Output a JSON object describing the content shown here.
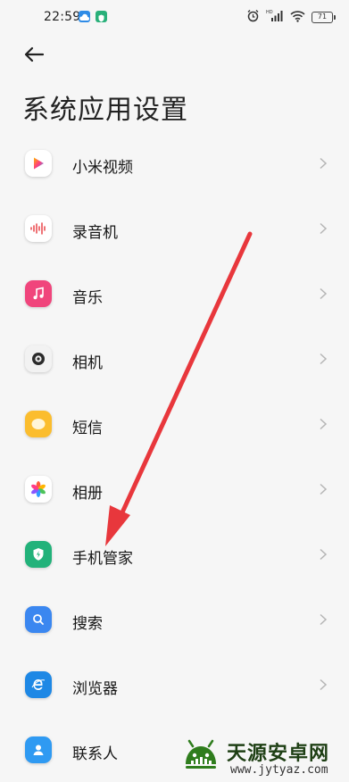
{
  "status_bar": {
    "time": "22:59",
    "battery": "71",
    "icons": [
      "cloud-icon",
      "shield-icon",
      "alarm-icon",
      "hd-signal-icon",
      "wifi-icon",
      "battery-icon"
    ]
  },
  "header": {
    "back_icon": "back-arrow-icon",
    "title": "系统应用设置"
  },
  "settings_list": [
    {
      "label": "小米视频",
      "icon": "video-play-icon"
    },
    {
      "label": "录音机",
      "icon": "recorder-waveform-icon"
    },
    {
      "label": "音乐",
      "icon": "music-note-icon"
    },
    {
      "label": "相机",
      "icon": "camera-lens-icon"
    },
    {
      "label": "短信",
      "icon": "message-bubble-icon"
    },
    {
      "label": "相册",
      "icon": "gallery-flower-icon"
    },
    {
      "label": "手机管家",
      "icon": "security-shield-icon"
    },
    {
      "label": "搜索",
      "icon": "search-icon"
    },
    {
      "label": "浏览器",
      "icon": "browser-e-icon"
    },
    {
      "label": "联系人",
      "icon": "contacts-person-icon"
    }
  ],
  "annotation": {
    "arrow_color": "#e8373c"
  },
  "watermark": {
    "title": "天源安卓网",
    "url": "www.jytyaz.com"
  },
  "colors": {
    "background": "#f6f6f6",
    "chevron": "#b5b5b5"
  }
}
